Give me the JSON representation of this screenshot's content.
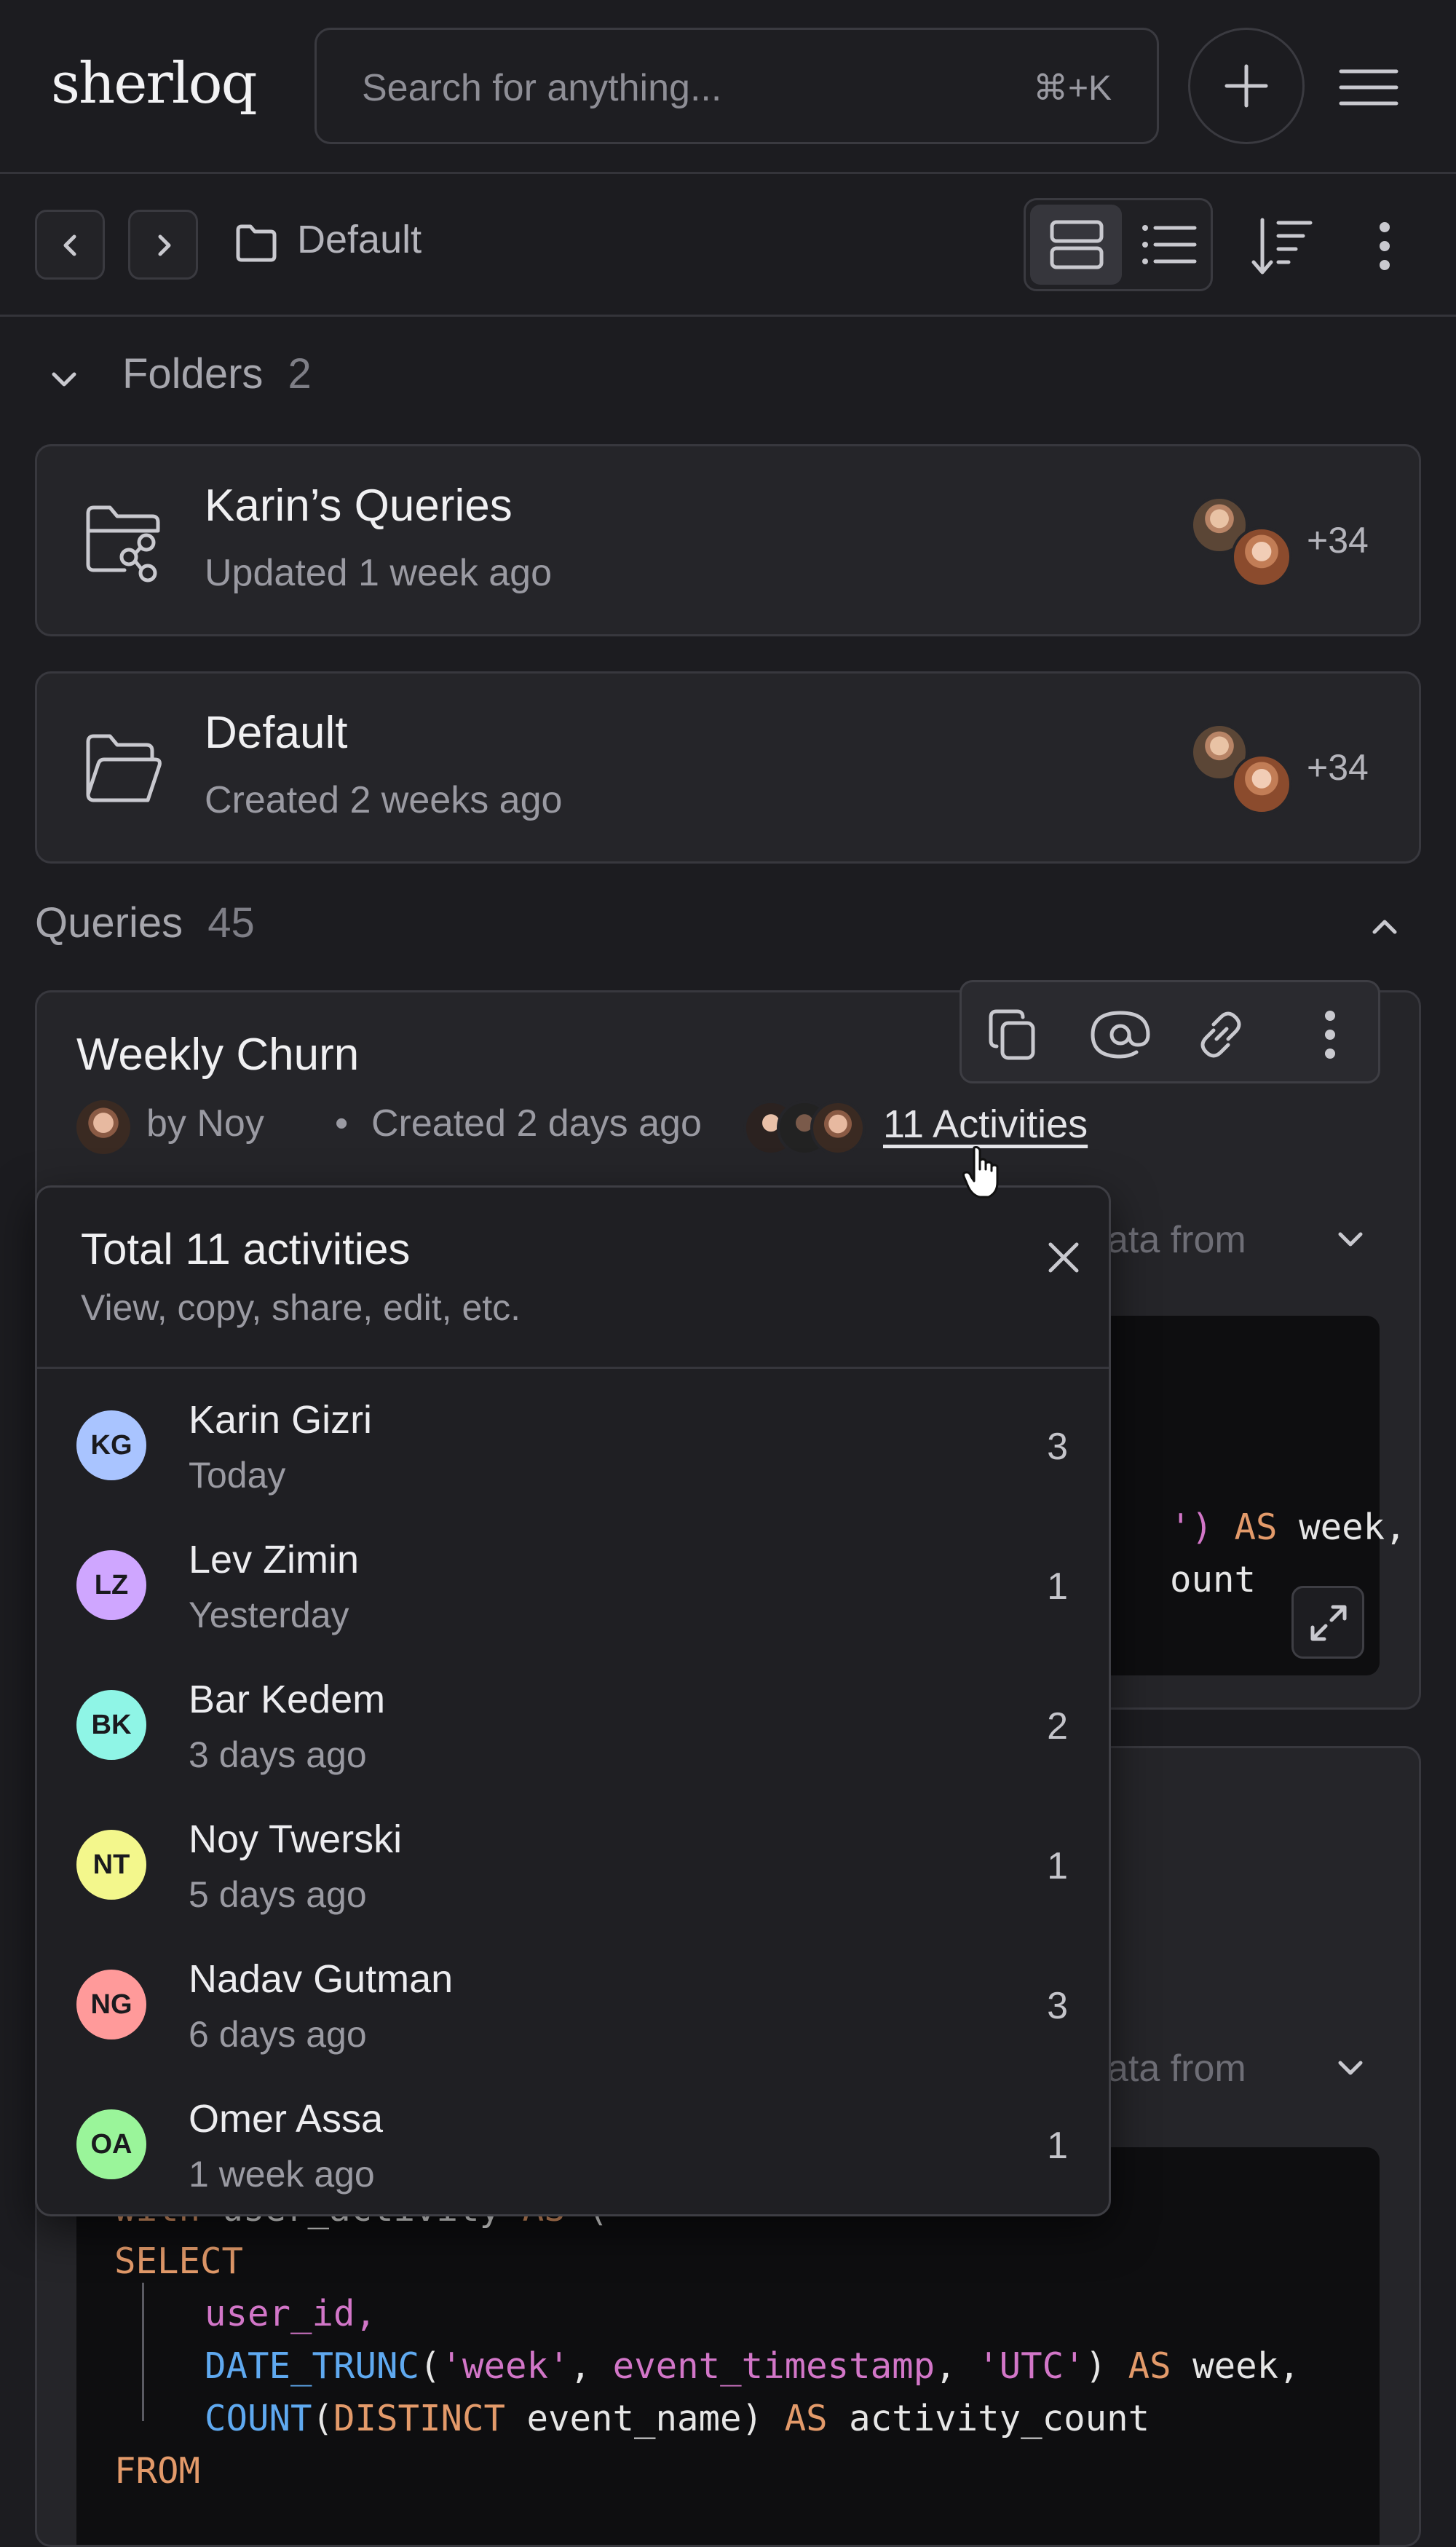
{
  "app": {
    "logo": "sherloq"
  },
  "search": {
    "placeholder": "Search for anything...",
    "shortcut": "⌘+K"
  },
  "toolbar": {
    "breadcrumb": "Default"
  },
  "folders": {
    "heading": "Folders",
    "count": "2",
    "items": [
      {
        "name": "Karin’s Queries",
        "subtitle": "Updated 1 week ago",
        "more": "+34",
        "icon": "shared-folder-icon"
      },
      {
        "name": "Default",
        "subtitle": "Created 2 weeks ago",
        "more": "+34",
        "icon": "folder-icon"
      }
    ]
  },
  "queries": {
    "heading": "Queries",
    "count": "45",
    "items": [
      {
        "title": "Weekly Churn",
        "author": "by Noy",
        "created": "Created 2 days ago",
        "activities_label": "11 Activities",
        "description_fragment": "ata from"
      },
      {
        "description_fragment": "ata from"
      }
    ]
  },
  "code_fragments": {
    "q1_line1_str": "')",
    "q1_line1_as": "AS",
    "q1_line1_rest": "week,",
    "q1_line2": "ount"
  },
  "code": {
    "line0": [
      "with",
      "user_activity",
      "AS",
      "("
    ],
    "line1": "SELECT",
    "line2": "user_id,",
    "line3": [
      "DATE_TRUNC",
      "(",
      "'week'",
      ", ",
      "event_timestamp",
      ", ",
      "'UTC'",
      ") ",
      "AS",
      " week,"
    ],
    "line4": [
      "COUNT",
      "(",
      "DISTINCT",
      " event_name) ",
      "AS",
      " activity_count"
    ],
    "line5": "FROM"
  },
  "activity_popover": {
    "title": "Total 11 activities",
    "subtitle": "View, copy, share, edit, etc.",
    "rows": [
      {
        "initials": "KG",
        "name": "Karin Gizri",
        "time": "Today",
        "count": "3",
        "color": "#a9c4ff"
      },
      {
        "initials": "LZ",
        "name": "Lev Zimin",
        "time": "Yesterday",
        "count": "1",
        "color": "#cfa6ff"
      },
      {
        "initials": "BK",
        "name": "Bar Kedem",
        "time": "3 days ago",
        "count": "2",
        "color": "#8ff5e6"
      },
      {
        "initials": "NT",
        "name": "Noy Twerski",
        "time": "5 days ago",
        "count": "1",
        "color": "#f3f78c"
      },
      {
        "initials": "NG",
        "name": "Nadav Gutman",
        "time": "6 days ago",
        "count": "3",
        "color": "#ff9a9a"
      },
      {
        "initials": "OA",
        "name": "Omer Assa",
        "time": "1 week ago",
        "count": "1",
        "color": "#9af59a"
      }
    ]
  },
  "colors": {
    "background": "#1c1c20",
    "card": "#252529",
    "keyword": "#e39a6a",
    "function": "#5fa9f0",
    "string": "#d276c8"
  }
}
